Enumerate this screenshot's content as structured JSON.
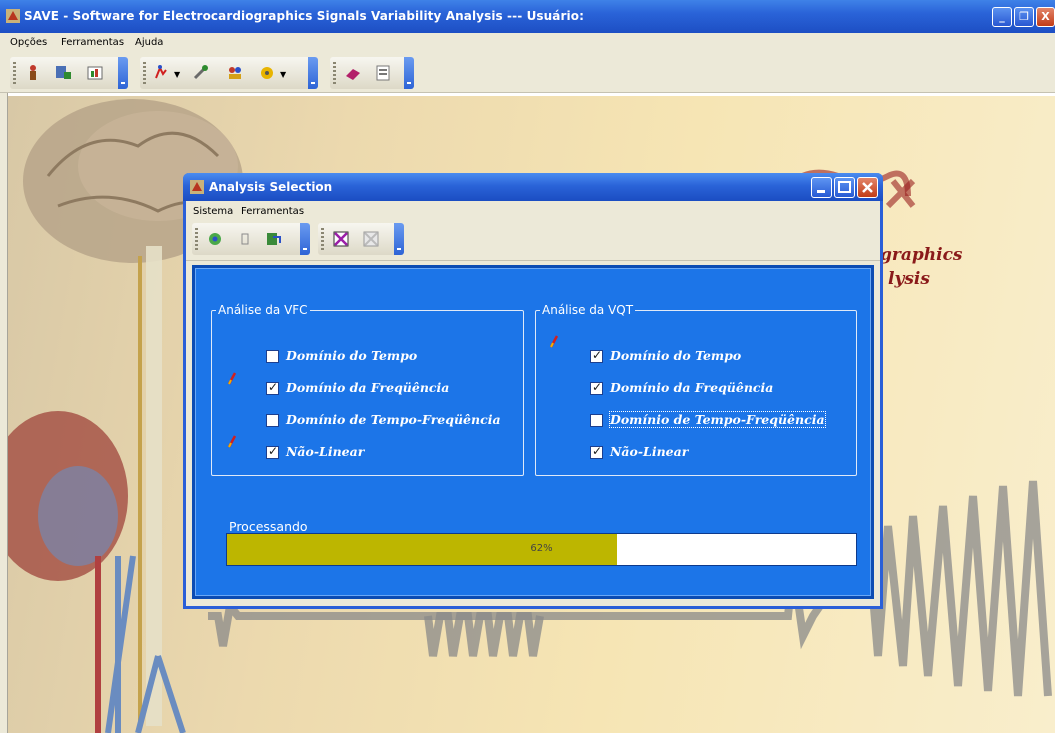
{
  "main_window": {
    "title": "SAVE - Software for Electrocardiographics Signals Variability Analysis --- Usuário:",
    "menu": [
      "Opções",
      "Ferramentas",
      "Ajuda"
    ],
    "toolbar_icons": [
      "user-icon",
      "open-record-icon",
      "chart-icon",
      "run-icon",
      "tools-icon",
      "users-icon",
      "settings-icon",
      "book-icon",
      "report-icon"
    ],
    "background_text": [
      "graphics",
      "lysis"
    ]
  },
  "dialog": {
    "title": "Analysis Selection",
    "menu": [
      "Sistema",
      "Ferramentas"
    ],
    "toolbar_icons": [
      "process-icon",
      "pause-icon",
      "export-icon",
      "cancel-icon",
      "clear-icon"
    ],
    "vfc": {
      "legend": "Análise da VFC",
      "options": [
        {
          "label": "Domínio do Tempo",
          "checked": false
        },
        {
          "label": "Domínio da Freqüência",
          "checked": true
        },
        {
          "label": "Domínio de Tempo-Freqüência",
          "checked": false
        },
        {
          "label": "Não-Linear",
          "checked": true
        }
      ]
    },
    "vqt": {
      "legend": "Análise da VQT",
      "options": [
        {
          "label": "Domínio do Tempo",
          "checked": true
        },
        {
          "label": "Domínio da Freqüência",
          "checked": true
        },
        {
          "label": "Domínio de Tempo-Freqüência",
          "checked": false
        },
        {
          "label": "Não-Linear",
          "checked": true
        }
      ]
    },
    "progress": {
      "label": "Processando",
      "percent": 62,
      "text": "62%"
    }
  },
  "colors": {
    "xp_blue": "#2a63d8",
    "panel_blue": "#1c75e8",
    "progress_fill": "#bdb600"
  }
}
